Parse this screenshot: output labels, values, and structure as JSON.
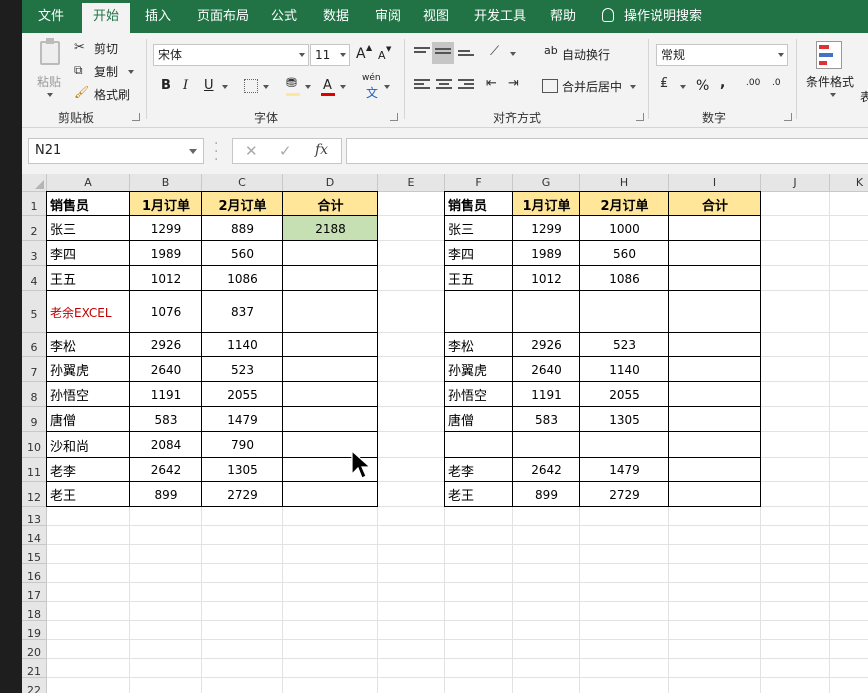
{
  "ribbon_tabs": [
    "文件",
    "开始",
    "插入",
    "页面布局",
    "公式",
    "数据",
    "审阅",
    "视图",
    "开发工具",
    "帮助"
  ],
  "active_tab": "开始",
  "tell_me": "操作说明搜索",
  "clipboard": {
    "paste": "粘贴",
    "cut": "剪切",
    "copy": "复制",
    "format_painter": "格式刷",
    "group": "剪贴板"
  },
  "font": {
    "name": "宋体",
    "size": "11",
    "bold": "B",
    "italic": "I",
    "underline": "U",
    "group": "字体",
    "grow": "A",
    "shrink": "A",
    "phonetic": "wén",
    "phonetic2": "文",
    "font_color": "A"
  },
  "alignment": {
    "wrap": "自动换行",
    "merge": "合并后居中",
    "group": "对齐方式",
    "ab_icon": "ab"
  },
  "number": {
    "format": "常规",
    "percent": "%",
    "comma": ",",
    "inc": ".00",
    "dec": ".0",
    "group": "数字"
  },
  "styles": {
    "conditional": "条件格式",
    "table_partial": "表"
  },
  "formula_bar": {
    "name_box": "N21",
    "cancel": "✕",
    "enter": "✓",
    "fx": "fx",
    "value": ""
  },
  "columns": [
    "A",
    "B",
    "C",
    "D",
    "E",
    "F",
    "G",
    "H",
    "I",
    "J",
    "K"
  ],
  "row_numbers": [
    "1",
    "2",
    "3",
    "4",
    "5",
    "6",
    "7",
    "8",
    "9",
    "10",
    "11",
    "12",
    "13",
    "14",
    "15",
    "16",
    "17",
    "18",
    "19",
    "20",
    "21",
    "22"
  ],
  "left_table": {
    "headers": [
      "销售员",
      "1月订单",
      "2月订单",
      "合计"
    ],
    "rows": [
      [
        "张三",
        "1299",
        "889",
        "2188"
      ],
      [
        "李四",
        "1989",
        "560",
        ""
      ],
      [
        "王五",
        "1012",
        "1086",
        ""
      ],
      [
        "老余EXCEL",
        "1076",
        "837",
        ""
      ],
      [
        "李松",
        "2926",
        "1140",
        ""
      ],
      [
        "孙翼虎",
        "2640",
        "523",
        ""
      ],
      [
        "孙悟空",
        "1191",
        "2055",
        ""
      ],
      [
        "唐僧",
        "583",
        "1479",
        ""
      ],
      [
        "沙和尚",
        "2084",
        "790",
        ""
      ],
      [
        "老李",
        "2642",
        "1305",
        ""
      ],
      [
        "老王",
        "899",
        "2729",
        ""
      ]
    ]
  },
  "right_table": {
    "headers": [
      "销售员",
      "1月订单",
      "2月订单",
      "合计"
    ],
    "rows": [
      [
        "张三",
        "1299",
        "1000",
        ""
      ],
      [
        "李四",
        "1989",
        "560",
        ""
      ],
      [
        "王五",
        "1012",
        "1086",
        ""
      ],
      [
        "",
        "",
        "",
        ""
      ],
      [
        "李松",
        "2926",
        "523",
        ""
      ],
      [
        "孙翼虎",
        "2640",
        "1140",
        ""
      ],
      [
        "孙悟空",
        "1191",
        "2055",
        ""
      ],
      [
        "唐僧",
        "583",
        "1305",
        ""
      ],
      [
        "",
        "",
        "",
        ""
      ],
      [
        "老李",
        "2642",
        "1479",
        ""
      ],
      [
        "老王",
        "899",
        "2729",
        ""
      ]
    ]
  },
  "colors": {
    "ribbon": "#217346",
    "header_fill": "#ffe699",
    "sum_fill": "#c6e0b4",
    "red_text": "#c00000"
  }
}
